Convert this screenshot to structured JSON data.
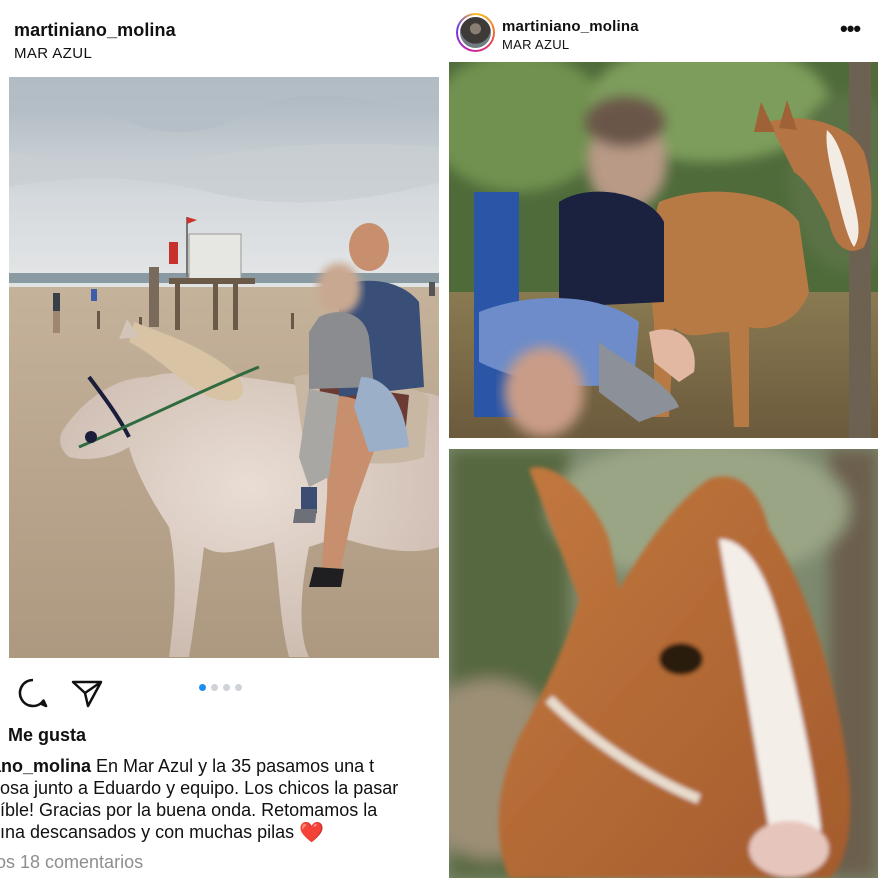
{
  "left_post": {
    "username": "martiniano_molina",
    "location": "MAR AZUL",
    "photo": "beach-horse-ride-photo",
    "actions": {
      "comment_icon": "comment-icon",
      "share_icon": "send-icon"
    },
    "carousel": {
      "count": 4,
      "active_index": 0
    },
    "likes_label": "Me gusta",
    "caption": {
      "username": "iniano_molina",
      "line1": " En Mar Azul y la 35 pasamos una t",
      "line2": "osa junto a Eduardo y equipo. Los chicos la pasar",
      "line3": "íble! Gracias por la buena onda. Retomamos la",
      "line4": "ına descansados y con muchas pilas ",
      "emoji": "❤️"
    },
    "comments_link": "os 18 comentarios"
  },
  "right_post": {
    "username": "martiniano_molina",
    "location": "MAR AZUL",
    "more_icon": "more-options-icon",
    "more_glyph": "•••",
    "photo_top": "child-with-foal-photo",
    "photo_bottom": "foal-closeup-photo"
  },
  "colors": {
    "accent": "#1a8ff0",
    "heart": "#e0182d",
    "muted_text": "#8e8e8e"
  }
}
